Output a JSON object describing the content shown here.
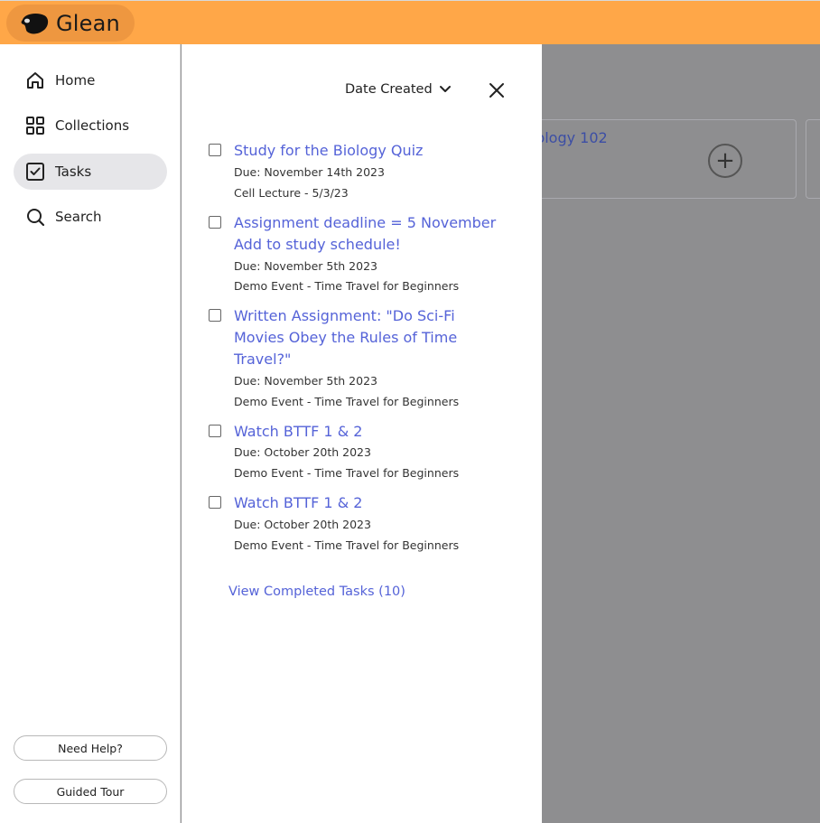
{
  "brand": {
    "name": "Glean"
  },
  "nav": {
    "items": [
      {
        "label": "Home",
        "icon": "home-icon"
      },
      {
        "label": "Collections",
        "icon": "grid-icon"
      },
      {
        "label": "Tasks",
        "icon": "checkbox-icon",
        "active": true
      },
      {
        "label": "Search",
        "icon": "search-icon"
      }
    ],
    "help_label": "Need Help?",
    "tour_label": "Guided Tour"
  },
  "background": {
    "card_title": "iology 102"
  },
  "tasks_panel": {
    "sort_label": "Date Created",
    "tasks": [
      {
        "title": "Study for the Biology Quiz",
        "due": "Due: November 14th 2023",
        "source": "Cell Lecture - 5/3/23"
      },
      {
        "title": "Assignment deadline = 5 November Add to study schedule!",
        "due": "Due: November 5th 2023",
        "source": "Demo Event - Time Travel for Beginners"
      },
      {
        "title": "Written Assignment: \"Do Sci-Fi Movies Obey the Rules of Time Travel?\"",
        "due": "Due: November 5th 2023",
        "source": "Demo Event - Time Travel for Beginners"
      },
      {
        "title": "Watch BTTF 1 & 2",
        "due": "Due: October 20th 2023",
        "source": "Demo Event - Time Travel for Beginners"
      },
      {
        "title": "Watch BTTF 1 & 2",
        "due": "Due: October 20th 2023",
        "source": "Demo Event - Time Travel for Beginners"
      }
    ],
    "view_completed_label": "View Completed Tasks (10)"
  },
  "colors": {
    "topbar": "#ffa748",
    "link": "#5563d8",
    "overlay": "#8e8e90"
  }
}
